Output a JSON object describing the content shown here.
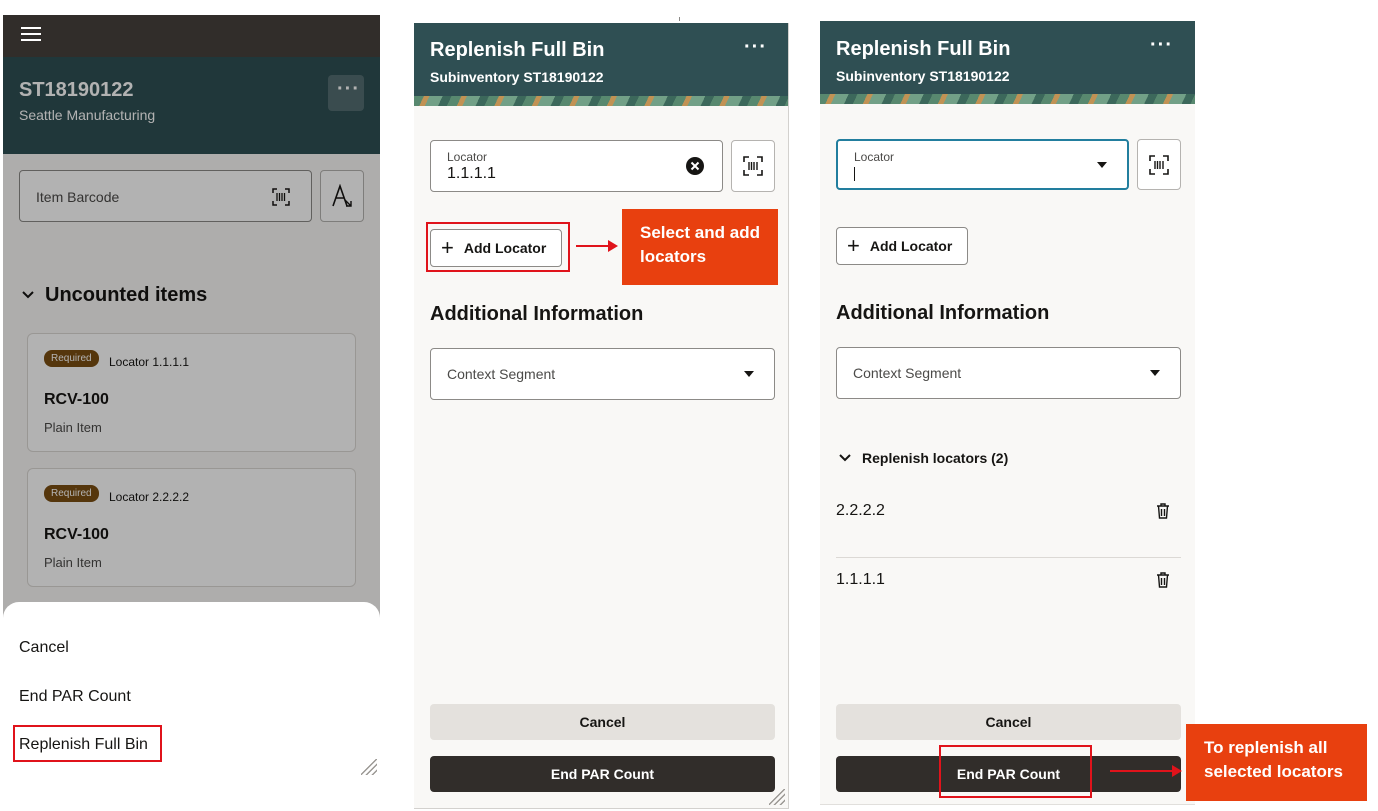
{
  "screen1": {
    "header_title": "ST18190122",
    "header_subtitle": "Seattle Manufacturing",
    "search_placeholder": "Item Barcode",
    "section_title": "Uncounted items",
    "items": [
      {
        "badge": "Required",
        "locator": "Locator 1.1.1.1",
        "name": "RCV-100",
        "desc": "Plain Item"
      },
      {
        "badge": "Required",
        "locator": "Locator 2.2.2.2",
        "name": "RCV-100",
        "desc": "Plain Item"
      }
    ],
    "sheet_options": [
      "Cancel",
      "End PAR Count",
      "Replenish Full Bin"
    ]
  },
  "screen2": {
    "title": "Replenish Full Bin",
    "subtitle": "Subinventory ST18190122",
    "locator_label": "Locator",
    "locator_value": "1.1.1.1",
    "add_locator_label": "Add Locator",
    "section_title": "Additional Information",
    "context_segment_label": "Context Segment",
    "cancel_label": "Cancel",
    "end_label": "End PAR Count"
  },
  "screen3": {
    "title": "Replenish Full Bin",
    "subtitle": "Subinventory ST18190122",
    "locator_label": "Locator",
    "add_locator_label": "Add Locator",
    "section_title": "Additional Information",
    "context_segment_label": "Context Segment",
    "replenish_header": "Replenish locators (2)",
    "locators": [
      "2.2.2.2",
      "1.1.1.1"
    ],
    "cancel_label": "Cancel",
    "end_label": "End PAR Count"
  },
  "callouts": {
    "add_locators": "Select and add locators",
    "replenish_all": "To replenish all selected locators"
  },
  "colors": {
    "header_teal": "#2f4f53",
    "dark_bar": "#312d2a",
    "callout_orange": "#e8400f",
    "highlight_red": "#e0131b",
    "badge_brown": "#7a4e12",
    "focus_blue": "#227e9e"
  }
}
